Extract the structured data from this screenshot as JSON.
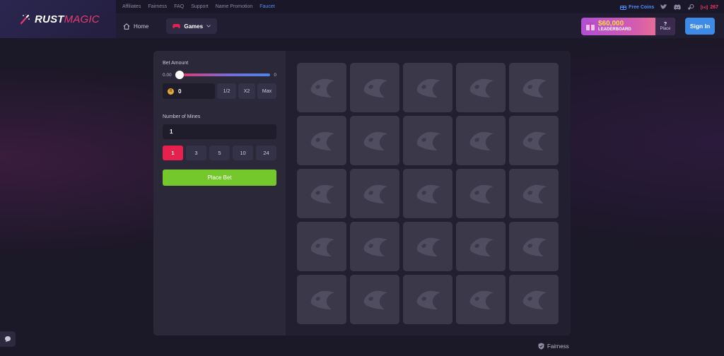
{
  "brand": {
    "part1": "RUST",
    "part2": "MAGIC"
  },
  "topbar": {
    "links": [
      "Affiliates",
      "Fairness",
      "FAQ",
      "Support",
      "Name Promotion",
      "Faucet"
    ],
    "free_coins": "Free Coins",
    "online_count": "267"
  },
  "nav": {
    "home": "Home",
    "games": "Games"
  },
  "leaderboard": {
    "amount": "$60,000",
    "label": "LEADERBOARD",
    "place_value": "?",
    "place_label": "Place"
  },
  "signin": "Sign In",
  "controls": {
    "bet_label": "Bet Amount",
    "slider_min": "0.00",
    "slider_max": "0",
    "slider_fraction": 0,
    "bet_value": "0",
    "half": "1/2",
    "double": "X2",
    "max": "Max",
    "mines_label": "Number of Mines",
    "mines_value": "1",
    "mine_options": [
      "1",
      "3",
      "5",
      "10",
      "24"
    ],
    "selected_mine_option": "1",
    "place_bet": "Place Bet"
  },
  "board": {
    "rows": 5,
    "cols": 5
  },
  "footer": {
    "fairness": "Fairness"
  },
  "colors": {
    "accent_red": "#e6204f",
    "accent_blue": "#3d8be6",
    "bet_green": "#75c82b"
  }
}
